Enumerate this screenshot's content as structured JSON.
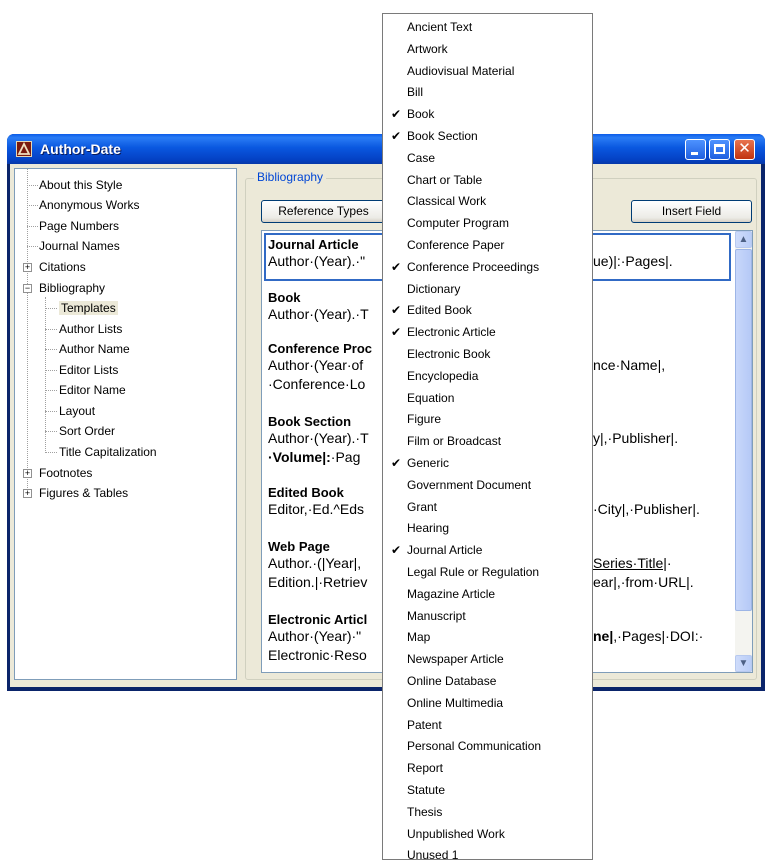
{
  "window": {
    "title": "Author-Date",
    "buttons": {
      "minimize": "minimize",
      "maximize": "maximize",
      "close": "✕"
    }
  },
  "tree": {
    "items": [
      {
        "label": "About this Style"
      },
      {
        "label": "Anonymous Works"
      },
      {
        "label": "Page Numbers"
      },
      {
        "label": "Journal Names"
      },
      {
        "label": "Citations",
        "expander": "+"
      },
      {
        "label": "Bibliography",
        "expander": "−"
      },
      {
        "label": "Templates",
        "selected": true
      },
      {
        "label": "Author Lists"
      },
      {
        "label": "Author Name"
      },
      {
        "label": "Editor Lists"
      },
      {
        "label": "Editor Name"
      },
      {
        "label": "Layout"
      },
      {
        "label": "Sort Order"
      },
      {
        "label": "Title Capitalization"
      },
      {
        "label": "Footnotes",
        "expander": "+"
      },
      {
        "label": "Figures & Tables",
        "expander": "+"
      }
    ]
  },
  "panel": {
    "group_label": "Bibliography",
    "reference_types_button": "Reference Types",
    "insert_field_button": "Insert Field",
    "scroll_up": "▲",
    "scroll_down": "▼",
    "entries": [
      {
        "title": "Journal Article",
        "line1": "Author·(Year).·\"",
        "line1_right": "ue)|:·Pages|."
      },
      {
        "title": "Book",
        "line1": "Author·(Year).·T"
      },
      {
        "title": "Conference Proc",
        "line1": "Author·(Year·of",
        "line1_right": "nce·Name|,",
        "line2": "·Conference·Lo"
      },
      {
        "title": "Book Section",
        "line1": "Author·(Year).·T",
        "line1_right": "y|,·Publisher|.",
        "line2_bold": "·Volume|:",
        "line2": "·Pag"
      },
      {
        "title": "Edited Book",
        "line1": "Editor,·Ed.^Eds",
        "line1_right": "·City|,·Publisher|."
      },
      {
        "title": "Web Page",
        "line1": "Author.·(|Year|,",
        "line1_right_u": "Series·Title|",
        "line1_right": "·",
        "line2": "Edition.|·Retriev",
        "line2_right": "ear|,·from·URL|."
      },
      {
        "title": "Electronic Articl",
        "line1": "Author·(Year)·\"",
        "line1_right_b": "ne|",
        "line1_right": ",·Pages|·DOI:·",
        "line2": "Electronic·Reso"
      }
    ]
  },
  "menu": {
    "items": [
      {
        "label": "Ancient Text",
        "checked": false
      },
      {
        "label": "Artwork",
        "checked": false
      },
      {
        "label": "Audiovisual Material",
        "checked": false
      },
      {
        "label": "Bill",
        "checked": false
      },
      {
        "label": "Book",
        "checked": true
      },
      {
        "label": "Book Section",
        "checked": true
      },
      {
        "label": "Case",
        "checked": false
      },
      {
        "label": "Chart or Table",
        "checked": false
      },
      {
        "label": "Classical Work",
        "checked": false
      },
      {
        "label": "Computer Program",
        "checked": false
      },
      {
        "label": "Conference Paper",
        "checked": false
      },
      {
        "label": "Conference Proceedings",
        "checked": true
      },
      {
        "label": "Dictionary",
        "checked": false
      },
      {
        "label": "Edited Book",
        "checked": true
      },
      {
        "label": "Electronic Article",
        "checked": true
      },
      {
        "label": "Electronic Book",
        "checked": false
      },
      {
        "label": "Encyclopedia",
        "checked": false
      },
      {
        "label": "Equation",
        "checked": false
      },
      {
        "label": "Figure",
        "checked": false
      },
      {
        "label": "Film or Broadcast",
        "checked": false
      },
      {
        "label": "Generic",
        "checked": true
      },
      {
        "label": "Government Document",
        "checked": false
      },
      {
        "label": "Grant",
        "checked": false
      },
      {
        "label": "Hearing",
        "checked": false
      },
      {
        "label": "Journal Article",
        "checked": true
      },
      {
        "label": "Legal Rule or Regulation",
        "checked": false
      },
      {
        "label": "Magazine Article",
        "checked": false
      },
      {
        "label": "Manuscript",
        "checked": false
      },
      {
        "label": "Map",
        "checked": false
      },
      {
        "label": "Newspaper Article",
        "checked": false
      },
      {
        "label": "Online Database",
        "checked": false
      },
      {
        "label": "Online Multimedia",
        "checked": false
      },
      {
        "label": "Patent",
        "checked": false
      },
      {
        "label": "Personal Communication",
        "checked": false
      },
      {
        "label": "Report",
        "checked": false
      },
      {
        "label": "Statute",
        "checked": false
      },
      {
        "label": "Thesis",
        "checked": false
      },
      {
        "label": "Unpublished Work",
        "checked": false
      },
      {
        "label": "Unused 1",
        "checked": false
      }
    ],
    "check_glyph": "✔"
  },
  "colors": {
    "titlebar": "#0a58e0",
    "group_label": "#0046d5",
    "selection_border": "#316ac5",
    "dialog_bg": "#ece9d8"
  },
  "icons": [
    "app-icon",
    "minimize-icon",
    "maximize-icon",
    "close-icon",
    "checkmark-icon",
    "scroll-up-icon",
    "scroll-down-icon"
  ]
}
